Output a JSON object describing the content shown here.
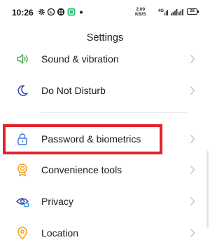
{
  "status_bar": {
    "time": "10:26",
    "net_speed_value": "2.00",
    "net_speed_unit": "KB/S",
    "battery": "28",
    "icons": [
      "gear-icon",
      "whatsapp-icon",
      "app-icon",
      "app-icon",
      "dot"
    ]
  },
  "header": {
    "title": "Settings"
  },
  "menu": {
    "items": [
      {
        "label": "Sound & vibration",
        "icon": "speaker-icon"
      },
      {
        "label": "Do Not Disturb",
        "icon": "moon-icon"
      },
      {
        "label": "Password & biometrics",
        "icon": "lock-icon",
        "highlighted": true
      },
      {
        "label": "Convenience tools",
        "icon": "convenience-icon"
      },
      {
        "label": "Privacy",
        "icon": "privacy-eye-icon"
      },
      {
        "label": "Location",
        "icon": "location-pin-icon"
      }
    ]
  },
  "colors": {
    "accent": "#3b7be0",
    "highlight": "#e5232c",
    "green": "#4caf50",
    "orange": "#f0a020"
  }
}
